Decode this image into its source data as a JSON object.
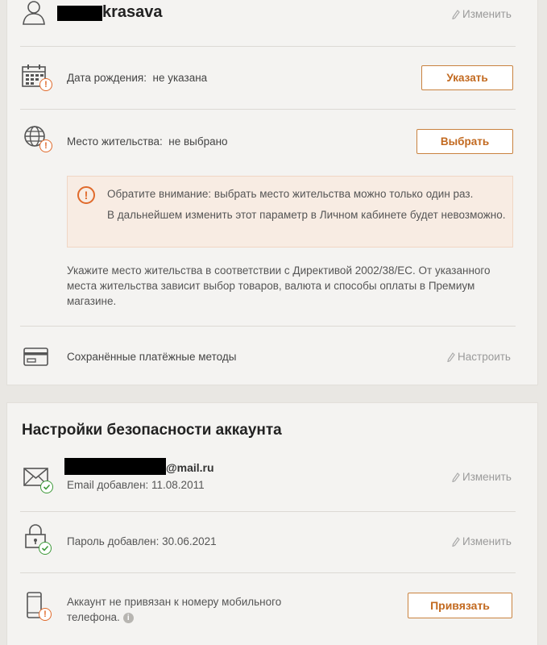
{
  "profile": {
    "username_suffix": "krasava",
    "edit_label": "Изменить"
  },
  "birthday": {
    "label": "Дата рождения:",
    "value": "не указана",
    "button": "Указать"
  },
  "residence": {
    "label": "Место жительства:",
    "value": "не выбрано",
    "button": "Выбрать",
    "notice_line1": "Обратите внимание: выбрать место жительства можно только один раз.",
    "notice_line2": "В дальнейшем изменить этот параметр в Личном кабинете будет невозможно.",
    "info": "Укажите место жительства в соответствии с Директивой 2002/38/EC. От указанного места жительства зависит выбор товаров, валюта и способы оплаты в Премиум магазине."
  },
  "payment": {
    "label": "Сохранённые платёжные методы",
    "configure_label": "Настроить"
  },
  "security": {
    "title": "Настройки безопасности аккаунта",
    "email_domain": "@mail.ru",
    "email_added": "Email добавлен: 11.08.2011",
    "email_edit": "Изменить",
    "password_added": "Пароль добавлен: 30.06.2021",
    "password_edit": "Изменить",
    "phone_text_line1": "Аккаунт не привязан к номеру мобильного",
    "phone_text_line2": "телефона.",
    "phone_button": "Привязать"
  },
  "colors": {
    "accent": "#c2691f",
    "warning": "#e06a2b",
    "success": "#3e9a3a",
    "background": "#e9e7e3",
    "card": "#f4f3f1"
  }
}
